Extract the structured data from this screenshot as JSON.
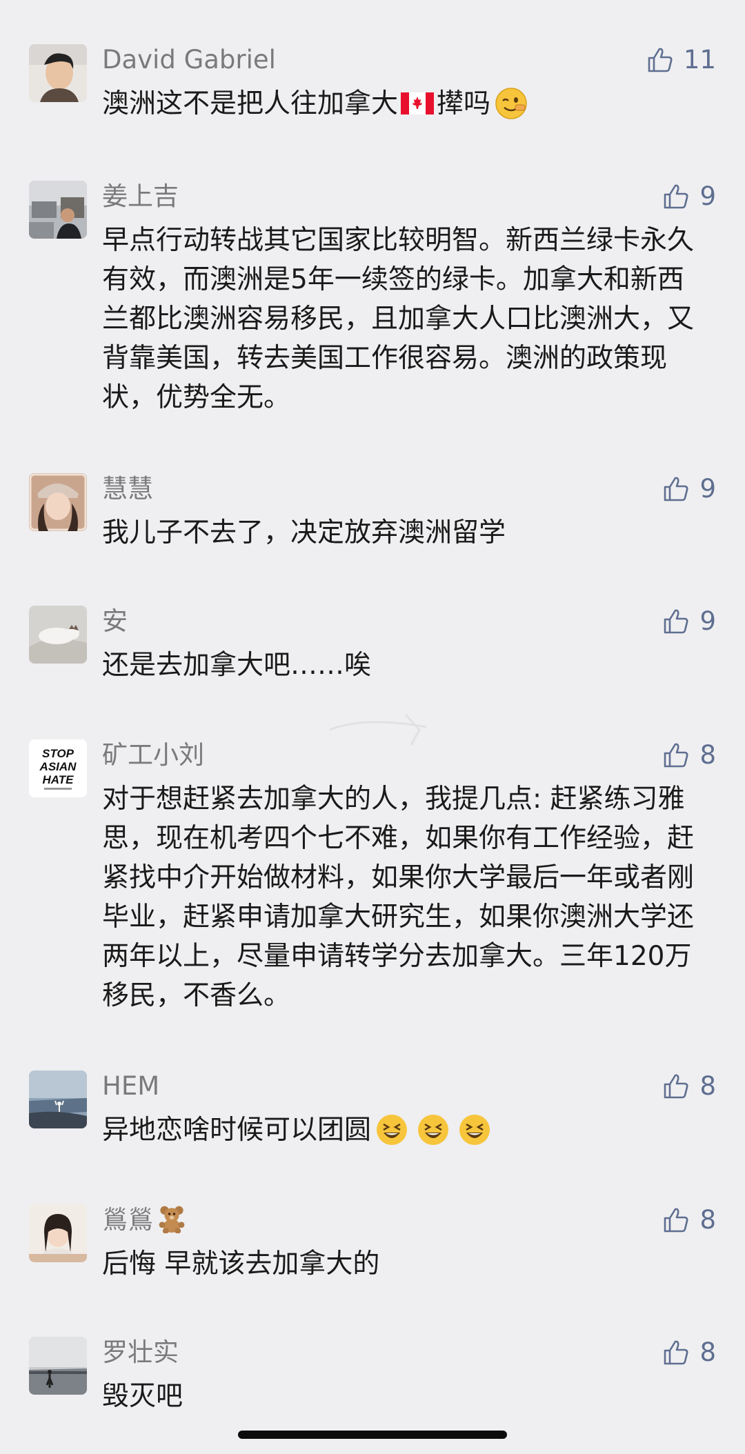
{
  "comments": [
    {
      "name": "David Gabriel",
      "likes": "11",
      "text_before": "澳洲这不是把人往加拿大",
      "text_after": "撵吗",
      "flag_icon": "canada-flag",
      "end_emoji": "wink-face-emoji"
    },
    {
      "name": "姜上吉",
      "likes": "9",
      "text": "早点行动转战其它国家比较明智。新西兰绿卡永久有效，而澳洲是5年一续签的绿卡。加拿大和新西兰都比澳洲容易移民，且加拿大人口比澳洲大，又背靠美国，转去美国工作很容易。澳洲的政策现状，优势全无。"
    },
    {
      "name": "慧慧",
      "likes": "9",
      "text": "我儿子不去了，决定放弃澳洲留学"
    },
    {
      "name": "安",
      "likes": "9",
      "text": "还是去加拿大吧……唉"
    },
    {
      "name": "矿工小刘",
      "likes": "8",
      "text": "对于想赶紧去加拿大的人，我提几点: 赶紧练习雅思，现在机考四个七不难，如果你有工作经验，赶紧找中介开始做材料，如果你大学最后一年或者刚毕业，赶紧申请加拿大研究生，如果你澳洲大学还两年以上，尽量申请转学分去加拿大。三年120万移民，不香么。",
      "avatar_text": [
        "STOP",
        "ASIAN",
        "HATE"
      ]
    },
    {
      "name": "HEM",
      "likes": "8",
      "text": "异地恋啥时候可以团圆",
      "emoji": "laughing-face-emoji"
    },
    {
      "name": "鶑鶑",
      "likes": "8",
      "text": "后悔 早就该去加拿大的",
      "name_emoji": "teddy-bear-emoji"
    },
    {
      "name": "罗壮实",
      "likes": "8",
      "text": "毁灭吧"
    }
  ],
  "colors": {
    "background": "#efeff1",
    "name": "#7a7a7c",
    "text": "#1a1a1a",
    "like": "#5e6e90"
  },
  "icons": {
    "like": "thumbs-up-icon"
  }
}
